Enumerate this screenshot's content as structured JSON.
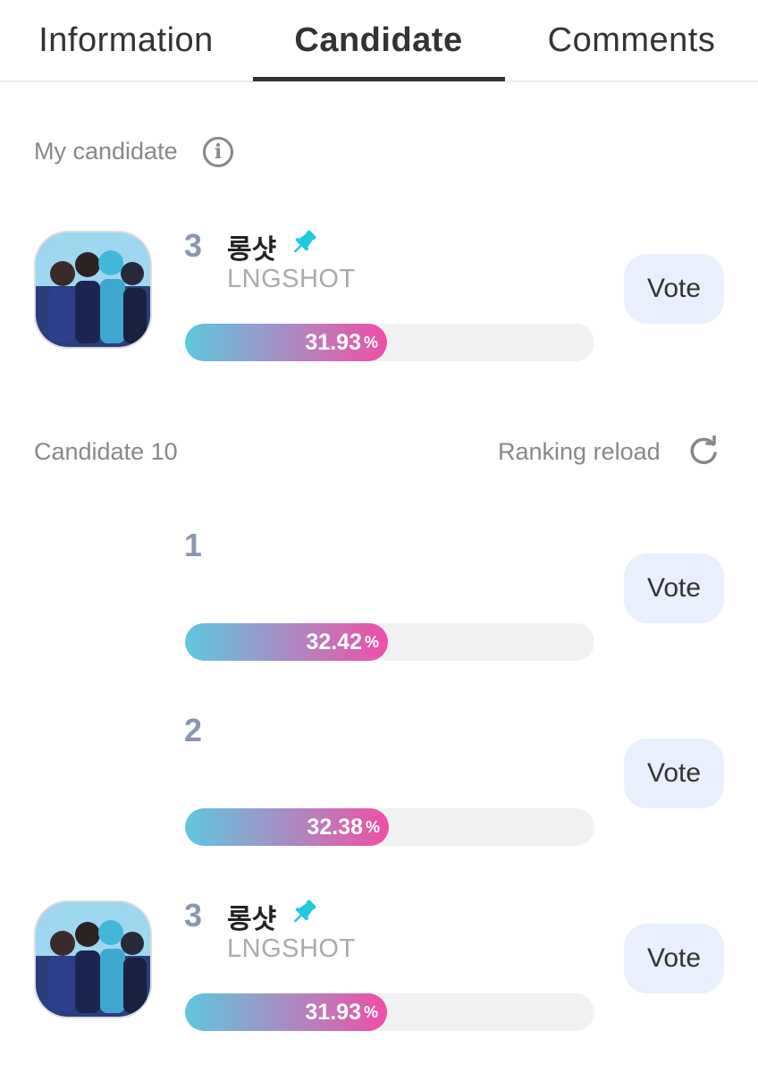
{
  "tabs": [
    {
      "label": "Information"
    },
    {
      "label": "Candidate"
    },
    {
      "label": "Comments"
    }
  ],
  "my_candidate": {
    "title": "My candidate",
    "rank": "3",
    "name": "롱샷",
    "subname": "LNGSHOT",
    "percent": "31.93",
    "percent_value": 31.93,
    "unit": "%",
    "vote_label": "Vote"
  },
  "candidates_header": {
    "title": "Candidate 10",
    "reload_label": "Ranking reload"
  },
  "candidates": [
    {
      "rank": "1",
      "name": "",
      "subname": "",
      "percent": "32.42",
      "percent_value": 32.42,
      "unit": "%",
      "vote_label": "Vote"
    },
    {
      "rank": "2",
      "name": "",
      "subname": "",
      "percent": "32.38",
      "percent_value": 32.38,
      "unit": "%",
      "vote_label": "Vote"
    },
    {
      "rank": "3",
      "name": "롱샷",
      "subname": "LNGSHOT",
      "percent": "31.93",
      "percent_value": 31.93,
      "unit": "%",
      "vote_label": "Vote"
    }
  ],
  "colors": {
    "bar_gradient_start": "#5ec8df",
    "bar_gradient_end": "#ef4fa6",
    "pin": "#22c8e0",
    "vote_bg": "#e9effc",
    "rank": "#8a96b0"
  }
}
